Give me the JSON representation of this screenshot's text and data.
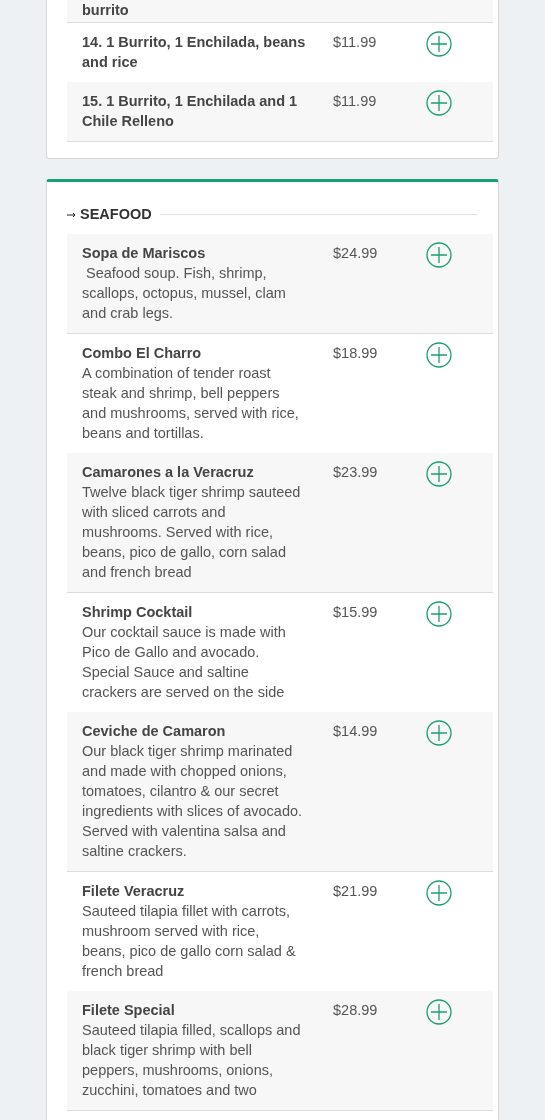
{
  "sections": [
    {
      "accent": false,
      "items": [
        {
          "name": "burrito"
        },
        {
          "name": "14. 1 Burrito, 1 Enchilada, beans and rice",
          "price": "$11.99"
        },
        {
          "name": "15. 1 Burrito, 1 Enchilada and 1 Chile Relleno",
          "price": "$11.99"
        }
      ]
    },
    {
      "title": "SEAFOOD",
      "accent": true,
      "items": [
        {
          "name": "Sopa de Mariscos",
          "price": "$24.99",
          "description": " Seafood soup. Fish, shrimp, scallops, octopus, mussel, clam and crab legs."
        },
        {
          "name": "Combo El Charro",
          "price": "$18.99",
          "description": "A combination of tender roast steak and shrimp, bell peppers and mushrooms, served with rice, beans and tortillas."
        },
        {
          "name": "Camarones a la Veracruz",
          "price": "$23.99",
          "description": "Twelve black tiger shrimp sauteed with sliced carrots and mushrooms. Served with rice, beans, pico de gallo, corn salad and french bread"
        },
        {
          "name": "Shrimp Cocktail",
          "price": "$15.99",
          "description": "Our cocktail sauce is made with Pico de Gallo and avocado. Special Sauce and saltine crackers are served on the side"
        },
        {
          "name": "Ceviche de Camaron",
          "price": "$14.99",
          "description": "Our black tiger shrimp marinated and made with chopped onions, tomatoes, cilantro & our secret ingredients with slices of avocado. Served with valentina salsa and saltine crackers."
        },
        {
          "name": "Filete Veracruz",
          "price": "$21.99",
          "description": "Sauteed tilapia fillet with carrots, mushroom served with rice, beans, pico de gallo corn salad & french bread"
        },
        {
          "name": "Filete Special",
          "price": "$28.99",
          "description": "Sauteed tilapia filled, scallops and black tiger shrimp with bell peppers, mushrooms, onions, zucchini, tomatoes and two"
        }
      ]
    }
  ]
}
